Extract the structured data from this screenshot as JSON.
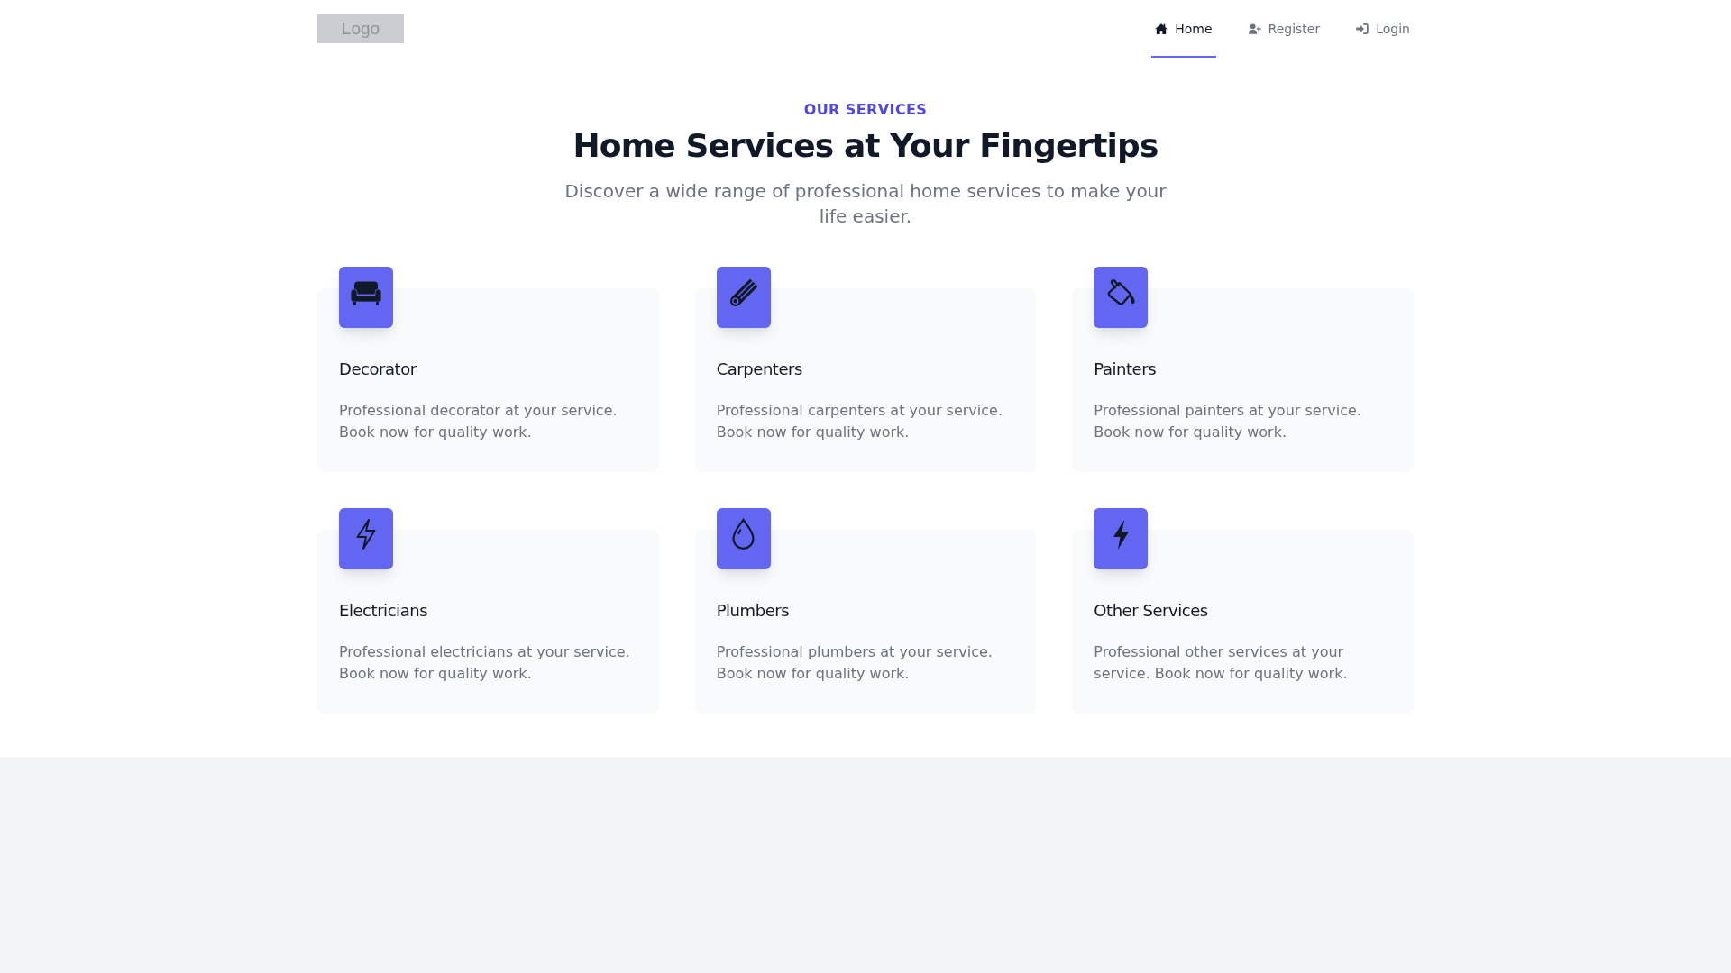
{
  "header": {
    "logo": "Logo",
    "nav": [
      {
        "label": "Home",
        "selected": true
      },
      {
        "label": "Register",
        "selected": false
      },
      {
        "label": "Login",
        "selected": false
      }
    ]
  },
  "services": {
    "eyebrow": "OUR SERVICES",
    "title": "Home Services at Your Fingertips",
    "subtitle": "Discover a wide range of professional home services to make your life easier.",
    "cards": [
      {
        "title": "Decorator",
        "description": "Professional decorator at your service. Book now for quality work."
      },
      {
        "title": "Carpenters",
        "description": "Professional carpenters at your service. Book now for quality work."
      },
      {
        "title": "Painters",
        "description": "Professional painters at your service. Book now for quality work."
      },
      {
        "title": "Electricians",
        "description": "Professional electricians at your service. Book now for quality work."
      },
      {
        "title": "Plumbers",
        "description": "Professional plumbers at your service. Book now for quality work."
      },
      {
        "title": "Other Services",
        "description": "Professional other services at your service. Book now for quality work."
      }
    ]
  }
}
